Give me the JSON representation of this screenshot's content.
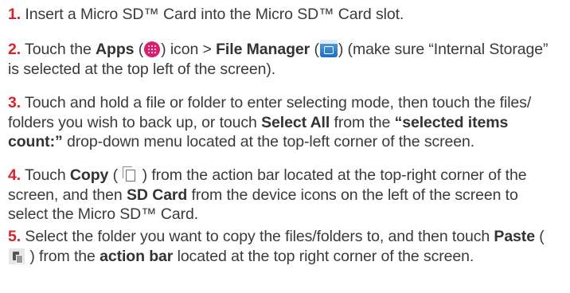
{
  "steps": [
    {
      "number": "1.",
      "text": "Insert a Micro SD™ Card into the Micro SD™ Card slot."
    },
    {
      "number": "2.",
      "t1": "Touch the ",
      "b1": "Apps",
      "t2": " (",
      "t3": ") icon > ",
      "b2": "File Manager",
      "t4": " (",
      "t5": ") (make sure “Internal Storage” is selected at the top left of the screen)."
    },
    {
      "number": "3.",
      "t1": "Touch and hold a file or folder to enter selecting mode, then touch the files/ folders you wish to back up, or touch ",
      "b1": "Select All",
      "t2": " from the ",
      "b2": "“selected items count:”",
      "t3": " drop-down menu located at the top-left corner of the screen."
    },
    {
      "number": "4.",
      "t1": "Touch ",
      "b1": "Copy",
      "t2": " ( ",
      "t3": " ) from the action bar located at the top-right corner of the screen, and then ",
      "b2": "SD Card",
      "t4": " from the device icons on the left of the screen to select the Micro SD™ Card."
    },
    {
      "number": "5.",
      "t1": "Select the folder you want to copy the files/folders to, and then touch ",
      "b1": "Paste",
      "t2": " ( ",
      "t3": " ) from the ",
      "b2": "action bar",
      "t4": " located at the top right corner of the screen."
    }
  ],
  "icons": {
    "apps": "apps-icon",
    "file_manager": "file-manager-icon",
    "copy": "copy-icon",
    "paste": "paste-icon"
  },
  "colors": {
    "step_number": "#d8232a",
    "text": "#3a3a3a",
    "apps_icon": "#d91e6b",
    "file_manager_icon": "#1d6fc2"
  }
}
